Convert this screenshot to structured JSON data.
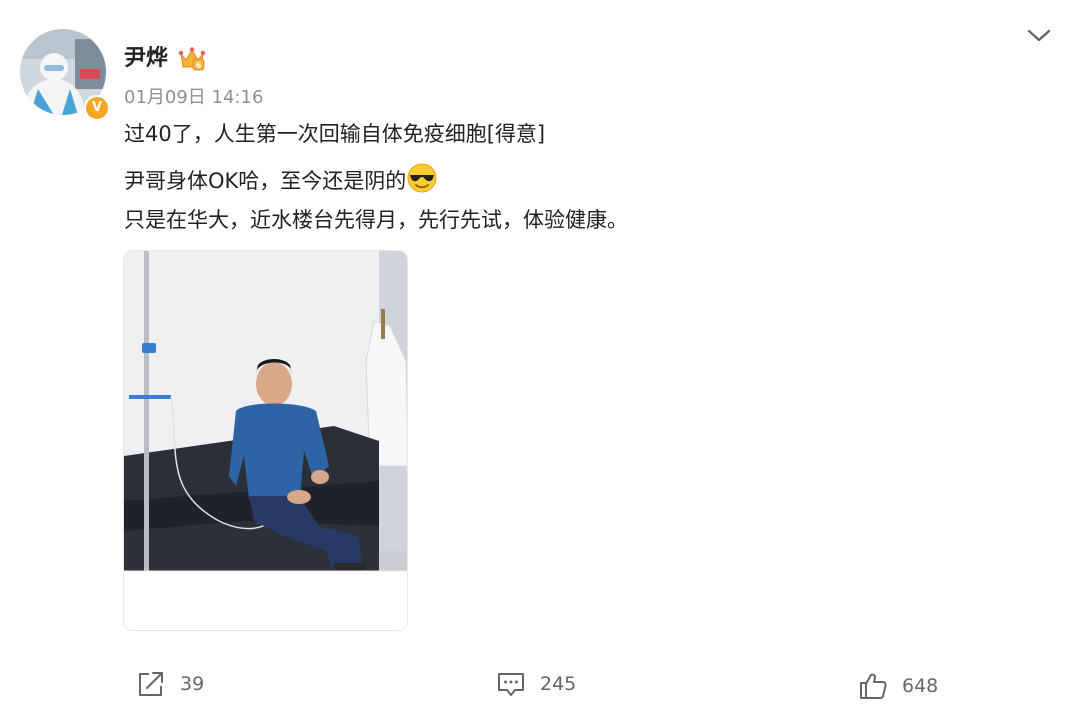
{
  "post": {
    "author": {
      "name": "尹烨",
      "verified_badge": "V",
      "crown_icon": "crown-icon"
    },
    "timestamp": "01月09日 14:16",
    "lines": [
      "过40了，人生第一次回输自体免疫细胞[得意]",
      "尹哥身体OK哈，至今还是阴的",
      "只是在华大，近水楼台先得月，先行先试，体验健康。"
    ],
    "emoji": "sunglasses-emoji-icon",
    "photo": {
      "icon": "photo-image"
    }
  },
  "actions": {
    "share": {
      "icon": "share-icon",
      "count": "39"
    },
    "comment": {
      "icon": "comment-icon",
      "count": "245"
    },
    "like": {
      "icon": "thumbs-up-icon",
      "count": "648"
    }
  },
  "menu": {
    "icon": "chevron-down-icon"
  },
  "colors": {
    "badge": "#f5a623",
    "text": "#222222",
    "muted": "#8f8f8f"
  }
}
